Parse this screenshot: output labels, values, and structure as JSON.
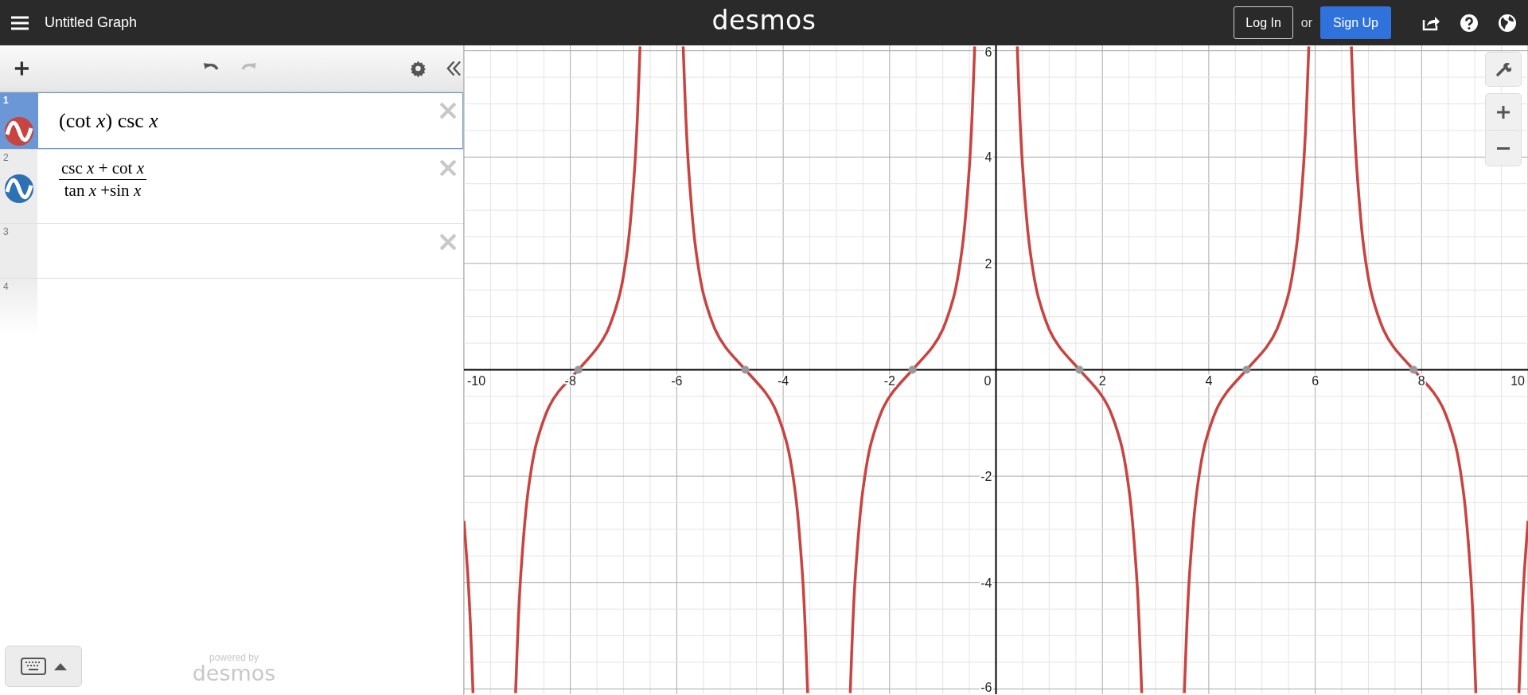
{
  "topbar": {
    "title": "Untitled Graph",
    "logo": "desmos",
    "login": "Log In",
    "or": "or",
    "signup": "Sign Up"
  },
  "toolbar": {
    "undo_disabled": false,
    "redo_disabled": true
  },
  "expressions": [
    {
      "number": "1",
      "kind": "plain",
      "text": "(cot *x*) csc *x*",
      "color": "#c74440",
      "selected": true
    },
    {
      "number": "2",
      "kind": "fraction",
      "numerator": "csc *x* +  cot *x*",
      "denominator": "tan *x* +sin *x*",
      "color": "#2d70b3",
      "selected": false
    },
    {
      "number": "3",
      "kind": "empty",
      "selected": false
    },
    {
      "number": "4",
      "kind": "placeholder",
      "selected": false
    }
  ],
  "footer": {
    "powered_by": "powered by",
    "logo": "desmos"
  },
  "graph": {
    "chart_data": {
      "type": "line",
      "grid": true,
      "xlim": [
        -10,
        10
      ],
      "ylim": [
        -6.1,
        6.1
      ],
      "xticks": [
        -10,
        -8,
        -6,
        -4,
        -2,
        0,
        2,
        4,
        6,
        8,
        10
      ],
      "yticks": [
        -6,
        -4,
        -2,
        2,
        4,
        6
      ],
      "x": [
        -10,
        -9.93,
        -9.88,
        -9.83,
        -9.03,
        -8.98,
        -8.93,
        -8.83,
        -8.73,
        -8.63,
        -8.43,
        -8.23,
        -7.85,
        -7.49,
        -7.29,
        -7.09,
        -6.99,
        -6.89,
        -6.79,
        -6.74,
        -6.69,
        -5.88,
        -5.83,
        -5.78,
        -5.68,
        -5.58,
        -5.48,
        -5.28,
        -5.08,
        -4.71,
        -4.34,
        -4.14,
        -3.94,
        -3.84,
        -3.74,
        -3.64,
        -3.59,
        -3.54,
        -2.74,
        -2.69,
        -2.64,
        -2.54,
        -2.44,
        -2.34,
        -2.14,
        -1.94,
        -1.57,
        -1.2,
        -1,
        -0.8,
        -0.7,
        -0.6,
        -0.5,
        -0.45,
        -0.4,
        0.4,
        0.45,
        0.5,
        0.6,
        0.7,
        0.8,
        1,
        1.2,
        1.57,
        1.94,
        2.14,
        2.34,
        2.44,
        2.54,
        2.64,
        2.69,
        2.74,
        3.54,
        3.59,
        3.64,
        3.74,
        3.84,
        3.94,
        4.14,
        4.34,
        4.71,
        5.08,
        5.28,
        5.48,
        5.58,
        5.68,
        5.78,
        5.83,
        5.88,
        6.68,
        6.73,
        6.78,
        6.88,
        6.98,
        7.08,
        7.28,
        7.48,
        7.85,
        8.22,
        8.42,
        8.62,
        8.72,
        8.82,
        8.92,
        8.97,
        9.02,
        9.83,
        9.88,
        9.93,
        10
      ],
      "series": [
        {
          "color": "#c74440",
          "values": [
            -2.84,
            -3.82,
            -4.76,
            -6.08,
            -6.08,
            -4.76,
            -3.82,
            -2.59,
            -1.84,
            -1.35,
            -0.76,
            -0.42,
            0,
            0.42,
            0.76,
            1.35,
            1.84,
            2.59,
            3.82,
            4.76,
            6.08,
            6.08,
            4.76,
            3.82,
            2.59,
            1.84,
            1.35,
            0.76,
            0.42,
            0,
            -0.42,
            -0.76,
            -1.35,
            -1.84,
            -2.59,
            -3.82,
            -4.76,
            -6.08,
            -6.08,
            -4.76,
            -3.82,
            -2.59,
            -1.84,
            -1.35,
            -0.76,
            -0.42,
            0,
            0.42,
            0.76,
            1.35,
            1.84,
            2.59,
            3.82,
            4.76,
            6.08,
            6.08,
            4.76,
            3.82,
            2.59,
            1.84,
            1.35,
            0.76,
            0.42,
            0,
            -0.42,
            -0.76,
            -1.35,
            -1.84,
            -2.59,
            -3.82,
            -4.76,
            -6.08,
            -6.08,
            -4.76,
            -3.82,
            -2.59,
            -1.84,
            -1.35,
            -0.76,
            -0.42,
            0,
            0.42,
            0.76,
            1.35,
            1.84,
            2.59,
            3.82,
            4.76,
            6.08,
            6.08,
            4.76,
            3.82,
            2.59,
            1.84,
            1.35,
            0.76,
            0.42,
            0,
            -0.42,
            -0.76,
            -1.35,
            -1.84,
            -2.59,
            -3.82,
            -4.76,
            -6.08,
            -6.08,
            -4.76,
            -3.82,
            -2.84
          ]
        }
      ]
    }
  }
}
